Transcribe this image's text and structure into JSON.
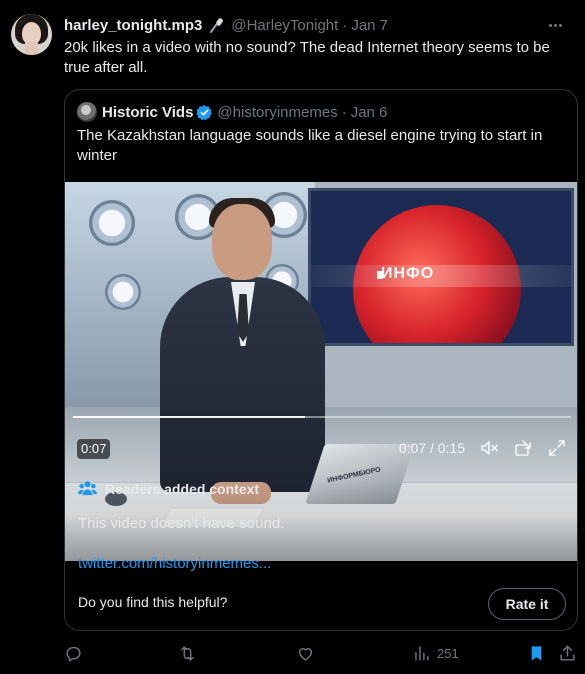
{
  "author": {
    "display_name": "harley_tonight.mp3",
    "badge_icon": "microphone-emoji",
    "handle": "@HarleyTonight",
    "separator": "·",
    "date": "Jan 7"
  },
  "tweet": {
    "text": "20k likes in a video with no sound? The dead Internet theory seems to be true after all."
  },
  "quoted": {
    "display_name": "Historic Vids",
    "verified": true,
    "handle": "@historyinmemes",
    "separator": "·",
    "date": "Jan 6",
    "text": "The Kazakhstan language sounds like a diesel engine trying to start in winter",
    "video": {
      "screen_text": "ИНФО",
      "laptop_text": "ИНФОРМБЮРО",
      "elapsed_badge": "0:07",
      "time_display": "0:07 / 0:15",
      "progress_fraction": 0.4667
    },
    "context": {
      "heading": "Readers added context",
      "body": "This video doesn't have sound.",
      "link": "twitter.com/historyinmemes...",
      "question": "Do you find this helpful?",
      "rate_button": "Rate it"
    }
  },
  "actions": {
    "reply_icon": "reply-icon",
    "retweet_icon": "retweet-icon",
    "like_icon": "heart-icon",
    "views_icon": "views-icon",
    "views_count": "251",
    "bookmark_icon": "bookmark-icon",
    "share_icon": "share-icon"
  },
  "colors": {
    "background": "#000000",
    "text": "#e7e9ea",
    "muted": "#71767b",
    "link": "#1d9bf0",
    "border": "#2f3336"
  }
}
